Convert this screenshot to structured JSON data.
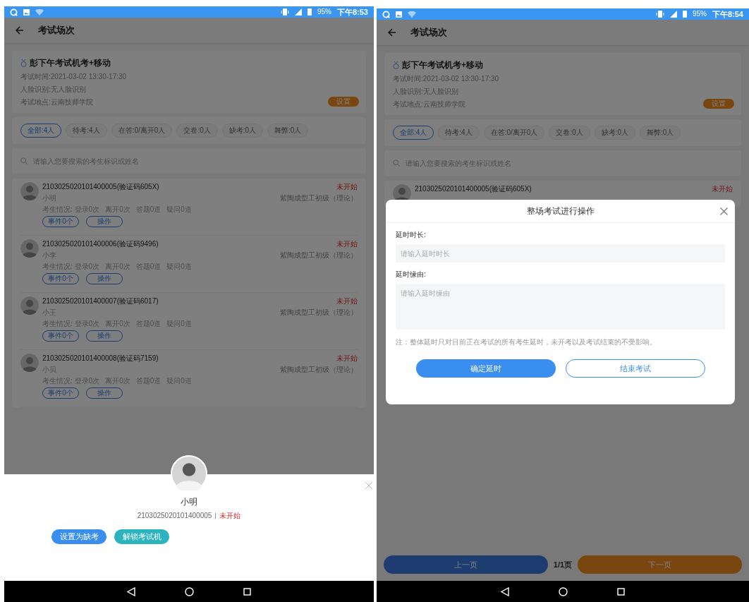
{
  "screens": [
    {
      "status_bar": {
        "battery": "95%",
        "time": "下午8:53"
      },
      "app_bar": {
        "title": "考试场次"
      },
      "exam": {
        "title": "彭下午考试机考+移动",
        "details": [
          "考试时间:2021-03-02 13:30-17:30",
          "人脸识别:无人脸识别",
          "考试地点:云南技师学院"
        ],
        "button": "设置"
      },
      "filters": [
        {
          "label": "全部:4人",
          "selected": true
        },
        {
          "label": "待考:4人",
          "selected": false
        },
        {
          "label": "在答:0/离开0人",
          "selected": false
        },
        {
          "label": "交卷:0人",
          "selected": false
        },
        {
          "label": "缺考:0人",
          "selected": false
        },
        {
          "label": "舞弊:0人",
          "selected": false
        }
      ],
      "search": {
        "placeholder": "请输入您要搜索的考生标识或姓名"
      },
      "students": [
        {
          "id": "2103025020101400005(验证码605X)",
          "name": "小明",
          "stats": [
            "考生情况: 登录0次",
            "离开0次",
            "答题0道",
            "疑问0道"
          ],
          "buttons": [
            "事件0个",
            "操作"
          ],
          "status": "未开始",
          "subject": "紫陶成型工初级（理论）"
        },
        {
          "id": "2103025020101400006(验证码9496)",
          "name": "小李",
          "stats": [
            "考生情况: 登录0次",
            "离开0次",
            "答题0道",
            "疑问0道"
          ],
          "buttons": [
            "事件0个",
            "操作"
          ],
          "status": "未开始",
          "subject": "紫陶成型工初级（理论）"
        },
        {
          "id": "2103025020101400007(验证码6017)",
          "name": "小王",
          "stats": [
            "考生情况: 登录0次",
            "离开0次",
            "答题0道",
            "疑问0道"
          ],
          "buttons": [
            "事件0个",
            "操作"
          ],
          "status": "未开始",
          "subject": "紫陶成型工初级（理论）"
        },
        {
          "id": "2103025020101400008(验证码7159)",
          "name": "小贝",
          "stats": [
            "考生情况: 登录0次",
            "离开0次",
            "答题0道",
            "疑问0道"
          ],
          "buttons": [
            "事件0个",
            "操作"
          ],
          "status": "未开始",
          "subject": "紫陶成型工初级（理论）"
        }
      ],
      "overlay": {
        "kind": "sheet",
        "name": "小明",
        "id": "2103025020101400005",
        "status": "未开始",
        "buttons": [
          {
            "label": "设置为缺考",
            "kind": "primary"
          },
          {
            "label": "解锁考试机",
            "kind": "secondary"
          }
        ]
      }
    },
    {
      "status_bar": {
        "battery": "95%",
        "time": "下午8:54"
      },
      "app_bar": {
        "title": "考试场次"
      },
      "exam": {
        "title": "彭下午考试机考+移动",
        "details": [
          "考试时间:2021-03-02 13:30-17:30",
          "人脸识别:无人脸识别",
          "考试地点:云南技师学院"
        ],
        "button": "设置"
      },
      "filters": [
        {
          "label": "全部:4人",
          "selected": true
        },
        {
          "label": "待考:4人",
          "selected": false
        },
        {
          "label": "在答:0/离开0人",
          "selected": false
        },
        {
          "label": "交卷:0人",
          "selected": false
        },
        {
          "label": "缺考:0人",
          "selected": false
        },
        {
          "label": "舞弊:0人",
          "selected": false
        }
      ],
      "search": {
        "placeholder": "请输入您要搜索的考生标识或姓名"
      },
      "students": [
        {
          "id": "2103025020101400005(验证码605X)",
          "status": "未开始"
        }
      ],
      "pagination": {
        "prev": "上一页",
        "page": "1/1页",
        "next": "下一页"
      },
      "overlay": {
        "kind": "dialog",
        "title": "整场考试进行操作",
        "fields": [
          {
            "label": "延时时长:",
            "placeholder": "请输入延时时长",
            "kind": "input"
          },
          {
            "label": "延时缘由:",
            "placeholder": "请输入延时缘由",
            "kind": "textarea"
          }
        ],
        "note": "注：整体延时只对目前正在考试的所有考生延时，未开考以及考试结束的不受影响。",
        "buttons": [
          {
            "label": "确定延时",
            "kind": "primary"
          },
          {
            "label": "结束考试",
            "kind": "outline"
          }
        ]
      }
    }
  ]
}
